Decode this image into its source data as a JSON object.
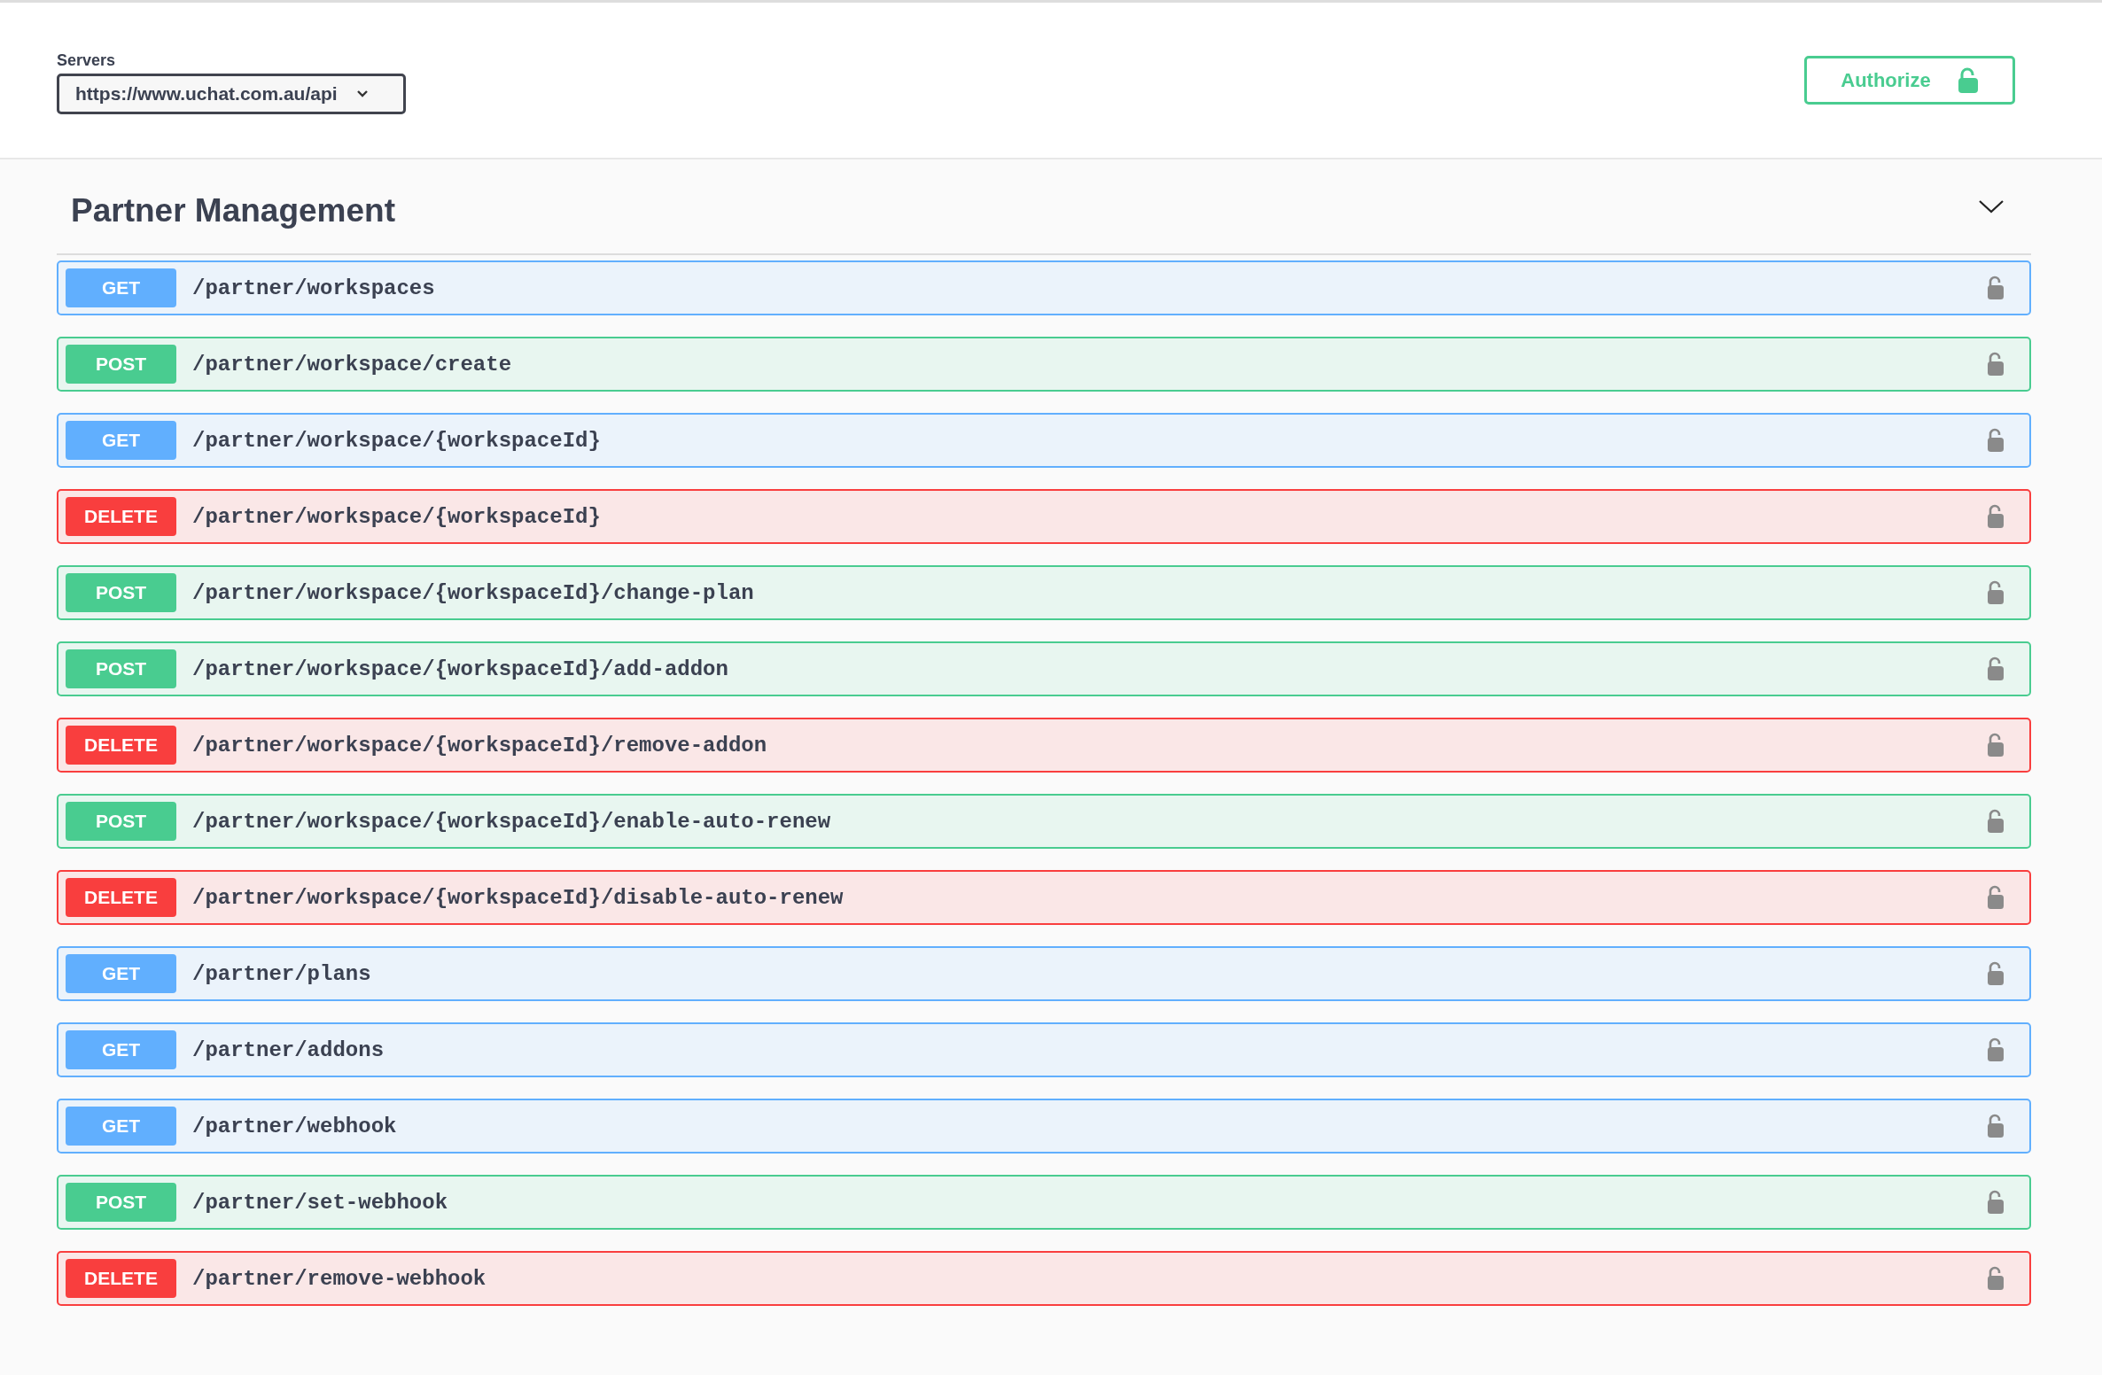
{
  "servers": {
    "label": "Servers",
    "value": "https://www.uchat.com.au/api"
  },
  "authorize": {
    "label": "Authorize"
  },
  "section": {
    "title": "Partner Management",
    "expanded": true,
    "operations": [
      {
        "kind": "get",
        "method": "GET",
        "path": "/partner/workspaces"
      },
      {
        "kind": "post",
        "method": "POST",
        "path": "/partner/workspace/create"
      },
      {
        "kind": "get",
        "method": "GET",
        "path": "/partner/workspace/{workspaceId}"
      },
      {
        "kind": "delete",
        "method": "DELETE",
        "path": "/partner/workspace/{workspaceId}"
      },
      {
        "kind": "post",
        "method": "POST",
        "path": "/partner/workspace/{workspaceId}/change-plan"
      },
      {
        "kind": "post",
        "method": "POST",
        "path": "/partner/workspace/{workspaceId}/add-addon"
      },
      {
        "kind": "delete",
        "method": "DELETE",
        "path": "/partner/workspace/{workspaceId}/remove-addon"
      },
      {
        "kind": "post",
        "method": "POST",
        "path": "/partner/workspace/{workspaceId}/enable-auto-renew"
      },
      {
        "kind": "delete",
        "method": "DELETE",
        "path": "/partner/workspace/{workspaceId}/disable-auto-renew"
      },
      {
        "kind": "get",
        "method": "GET",
        "path": "/partner/plans"
      },
      {
        "kind": "get",
        "method": "GET",
        "path": "/partner/addons"
      },
      {
        "kind": "get",
        "method": "GET",
        "path": "/partner/webhook"
      },
      {
        "kind": "post",
        "method": "POST",
        "path": "/partner/set-webhook"
      },
      {
        "kind": "delete",
        "method": "DELETE",
        "path": "/partner/remove-webhook"
      }
    ]
  }
}
